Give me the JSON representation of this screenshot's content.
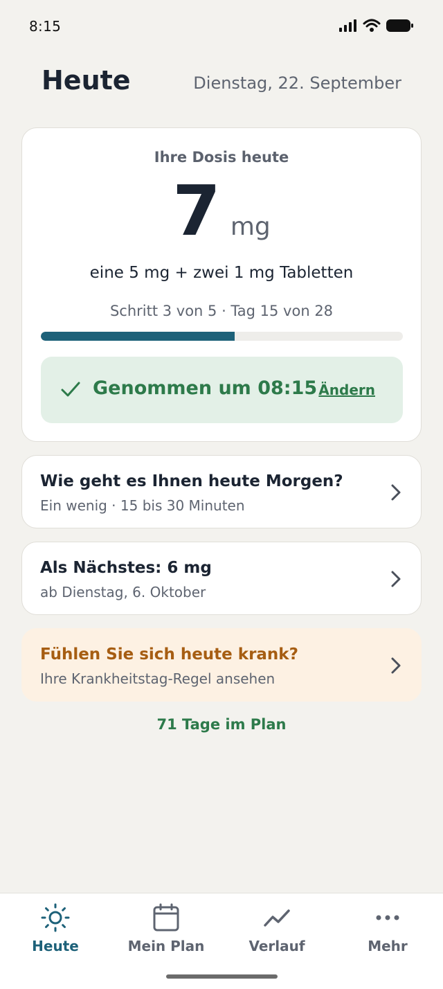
{
  "status_bar": {
    "time": "8:15"
  },
  "header": {
    "title": "Heute",
    "date": "Dienstag, 22. September"
  },
  "dose_card": {
    "heading": "Ihre Dosis heute",
    "dose_value": "7",
    "dose_unit": "mg",
    "description": "eine 5 mg + zwei 1 mg Tabletten",
    "step_text": "Schritt 3 von 5 · Tag 15 von 28",
    "progress_fraction": 0.536,
    "taken_text": "Genommen um 08:15",
    "change_label": "Ändern"
  },
  "cards": [
    {
      "title": "Wie geht es Ihnen heute Morgen?",
      "subtitle": "Ein wenig · 15 bis 30 Minuten"
    },
    {
      "title": "Als Nächstes: 6 mg",
      "subtitle": "ab Dienstag, 6. Oktober"
    },
    {
      "title": "Fühlen Sie sich heute krank?",
      "subtitle": "Ihre Krankheitstag-Regel ansehen"
    }
  ],
  "footer_note": "71 Tage im Plan",
  "tabs": [
    {
      "label": "Heute",
      "icon": "sun-icon",
      "active": true
    },
    {
      "label": "Mein Plan",
      "icon": "calendar-icon",
      "active": false
    },
    {
      "label": "Verlauf",
      "icon": "trend-icon",
      "active": false
    },
    {
      "label": "Mehr",
      "icon": "more-icon",
      "active": false
    }
  ],
  "colors": {
    "background": "#F3F2EE",
    "accent": "#1D6179",
    "success": "#2D7A4A",
    "success_bg": "#E3F0E7",
    "warning": "#A65D12",
    "warning_bg": "#FDF1E3"
  }
}
